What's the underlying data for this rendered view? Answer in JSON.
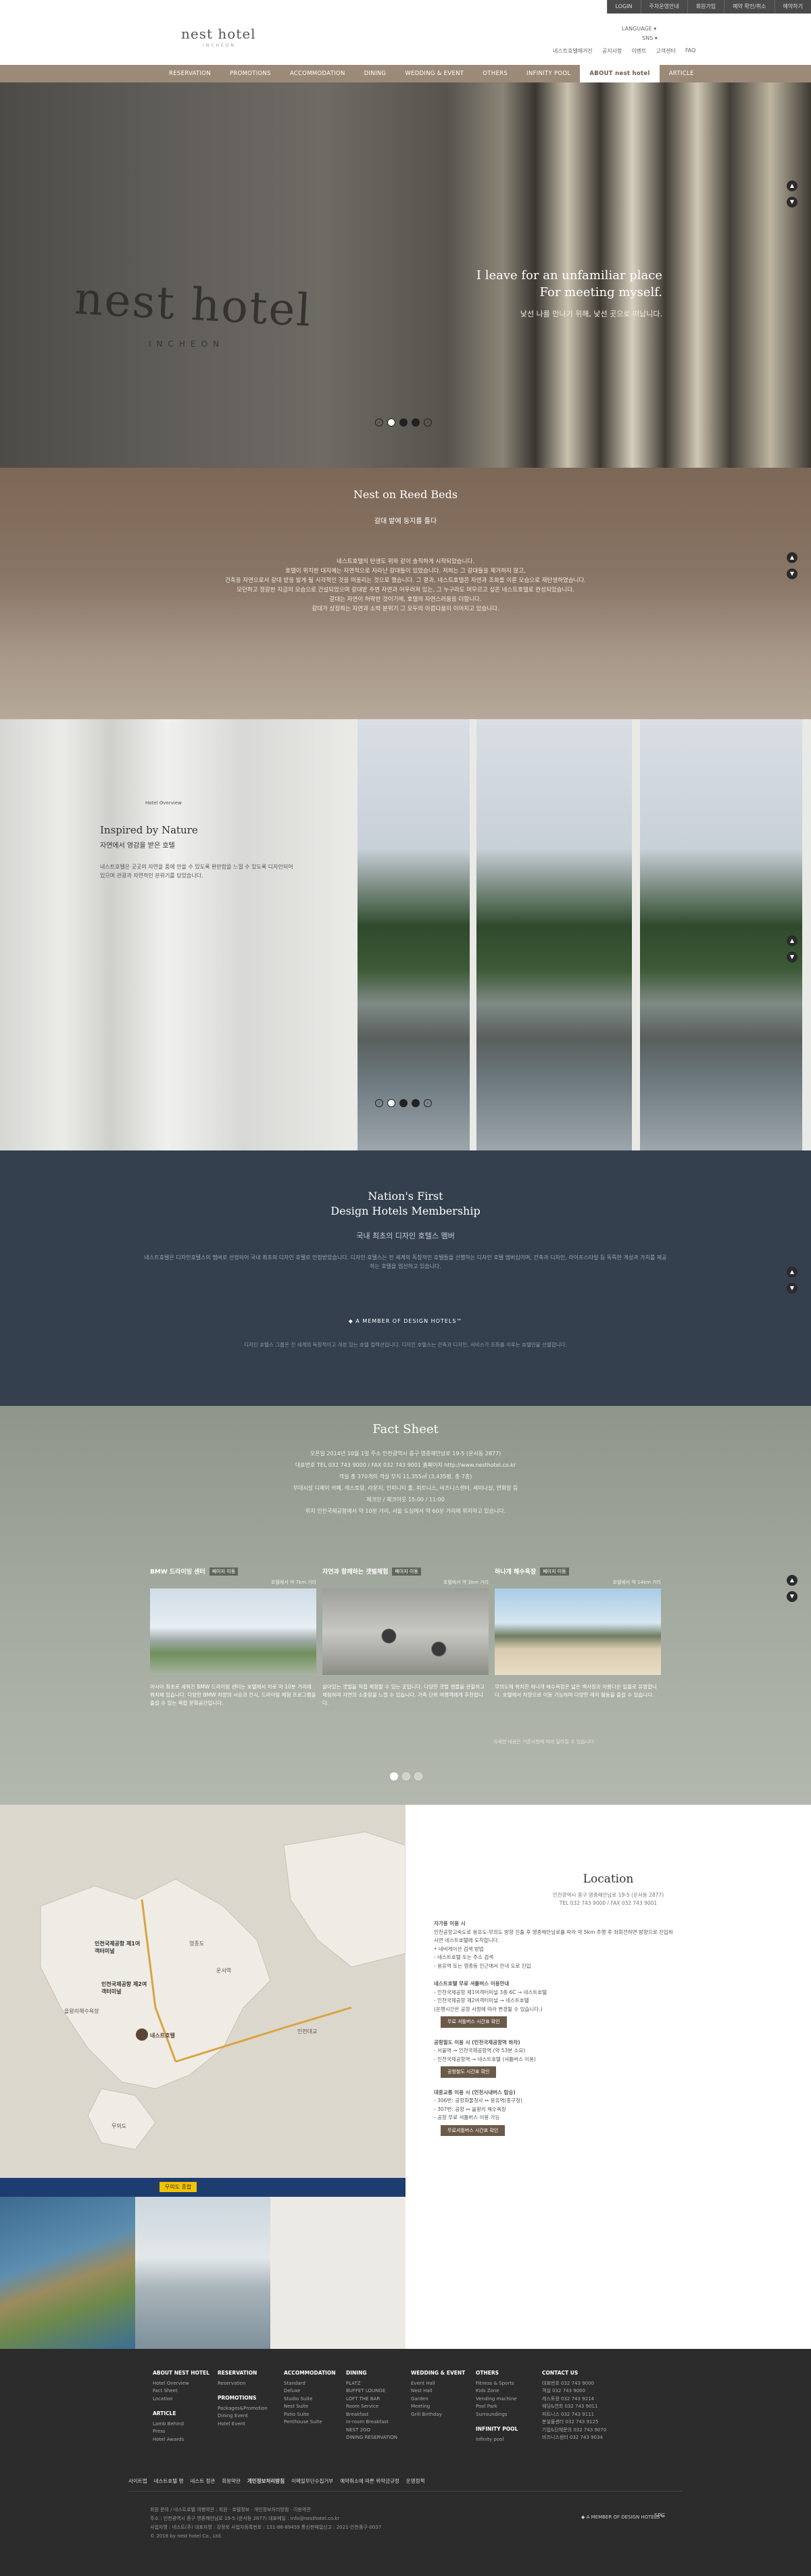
{
  "topbar": {
    "links": [
      "LOGIN",
      "주차운영안내",
      "회원가입",
      "예약 확인/취소",
      "예약하기"
    ]
  },
  "header": {
    "logo": "nest hotel",
    "logo_sub": "INCHEON",
    "language": "LANGUAGE",
    "sns": "SNS",
    "util_links": [
      "네스트호텔매거진",
      "공지사항",
      "이벤트",
      "고객센터",
      "FAQ"
    ]
  },
  "nav": {
    "items": [
      "RESERVATION",
      "PROMOTIONS",
      "ACCOMMODATION",
      "DINING",
      "WEDDING & EVENT",
      "OTHERS",
      "INFINITY POOL",
      "ABOUT nest hotel",
      "ARTICLE"
    ],
    "active_index": 7
  },
  "hero": {
    "logo_text": "nest hotel",
    "logo_sub": "INCHEON",
    "line1": "I leave for an unfamiliar place",
    "line2": "For meeting myself.",
    "line3": "낯선 나를 만나기 위해, 낯선 곳으로 떠납니다.",
    "slide_index": 1,
    "slide_count": 3
  },
  "reed": {
    "title": "Nest on Reed Beds",
    "subtitle": "갈대 밭에 둥지를 틀다",
    "body": [
      "네스트호텔의 탄생도 위와 같이 솔직하게 시작되었습니다.",
      "호텔이 위치한 대지에는 자연적으로 자라난 갈대들이 있었습니다. 저희는 그 갈대들을 제거하지 않고,",
      "건축을 자연으로서 갈대 밭을 밟게 될 시각적인 것을 떠올리는 것으로 했습니다. 그 결과, 네스트호텔은 자연과 조화를 이룬 모습으로 재탄생하였습니다.",
      "모던하고 정갈한 지금의 모습으로 건설되었으며 갈대밭 주변 자연과 어우러져 있는, 그 누구라도 머무르고 싶은 네스트호텔로 완성되었습니다.",
      "갈대는 자연이 허락한 것이기에, 호텔의 자연스러움을 더합니다.",
      "갈대가 상징하는 자연과 소박 분위기 그 모두의 아름다움이 이어지고 있습니다."
    ]
  },
  "inspired": {
    "eyebrow": "Hotel Overview",
    "title": "Inspired by Nature",
    "subtitle": "자연에서 영감을 받은 호텔",
    "body": "네스트호텔은 곳곳의 자연을 품에 안을 수 있도록 완만함을 느낄 수 있도록 디자인되어 있으며 관광과 자연적인 분위기를 담았습니다.",
    "slide_index": 0,
    "slide_count": 3
  },
  "membership": {
    "title_line1": "Nation's First",
    "title_line2": "Design Hotels  Membership",
    "subtitle": "국내 최초의 디자인 호텔스 멤버",
    "body": "네스트호텔은 디자인호텔스의 멤버로 선정되어 국내 최초의 디자인 호텔로 인정받았습니다. 디자인 호텔스는 전 세계의 독창적인 호텔들을 선별하는 디자인 호텔 멤버십이며, 건축과 디자인, 라이프스타일 등 독특한 개성과 가치를 제공하는 호텔을 엄선하고 있습니다.",
    "badge": "A MEMBER OF DESIGN HOTELS™",
    "badge_note": "디자인 호텔스 그룹은 전 세계의 독창적이고 개성 있는 호텔 컬렉션입니다. 디자인 호텔스는 건축과 디자인, 서비스가 조화를 이루는 호텔만을 선별합니다."
  },
  "fact": {
    "title": "Fact Sheet",
    "rows": [
      "오픈일  2014년 10월 1일    주소  인천광역시 중구 영종해안남로 19-5 (운서동 2877)",
      "대표번호  TEL 032 743 9000 / FAX 032 743 9001    홈페이지  http://www.nesthotel.co.kr",
      "객실  총 370개의 객실    부지  11,355㎡ (3,435평, 총 7층)",
      "부대시설  디제이 카페, 레스토랑, 라운지, 인피니티 풀, 피트니스, 비즈니스센터, 세미나실, 연회장 등",
      "체크인 / 체크아웃  15:00 / 11:00",
      "위치  인천국제공항에서 약 10분 거리, 서울 도심에서 약 60분 거리에 위치하고 있습니다."
    ],
    "columns": [
      {
        "title": "BMW 드라이빙 센터",
        "tag": "페이지 이동",
        "sub": "호텔에서 약 7km 거리",
        "text": "아시아 최초로 세워진 BMW 드라이빙 센터는 호텔에서 차로 약 10분 거리에 위치해 있습니다. 다양한 BMW 차량의 시승과 전시, 드라이빙 체험 프로그램을 즐길 수 있는 복합 문화공간입니다."
      },
      {
        "title": "자연과 함께하는 갯벌체험",
        "tag": "페이지 이동",
        "sub": "호텔에서 약 3km 거리",
        "text": "살아있는 갯벌을 직접 체험할 수 있는 곳입니다. 다양한 갯벌 생물을 관찰하고 체험하며 자연의 소중함을 느낄 수 있습니다. 가족 단위 여행객에게 추천합니다."
      },
      {
        "title": "하나개 해수욕장",
        "tag": "페이지 이동",
        "sub": "호텔에서 약 14km 거리",
        "text": "무의도에 위치한 하나개 해수욕장은 넓은 백사장과 아름다운 일몰로 유명합니다. 호텔에서 차량으로 이동 가능하며 다양한 레저 활동을 즐길 수 있습니다."
      }
    ],
    "note": "자세한 내용은 기준사항에 따라 달라질 수 있습니다.",
    "slide_index": 0,
    "slide_count": 3
  },
  "location": {
    "title": "Location",
    "address": "인천광역시 중구 영종해안남로 19-5 (운서동 2877)",
    "tel": "TEL 032 743 9000 / FAX 032 743 9001",
    "body_sections": [
      {
        "head": "자가용 이용 시",
        "lines": [
          "인천공항고속도로 용유도-무의도 방향 진출 후 영종해안남로를 따라 약 5km 주행 후 좌회전하면 방향으로 진입하시면 네스트호텔에 도착합니다.",
          "• 네비게이션 검색 방법",
          "  - 네스트호텔 또는 주소 검색",
          "  - 용유역 또는 영종동 인근에서 안내 도로 진입"
        ]
      },
      {
        "head": "네스트호텔 무료 셔틀버스 이용안내",
        "lines": [
          "- 인천국제공항 제1여객터미널 3층 6C → 네스트호텔",
          "- 인천국제공항 제2여객터미널 → 네스트호텔",
          "  (운행시간은 공항 사정에 따라 변경될 수 있습니다.)"
        ]
      },
      {
        "head": "공항철도 이용 시 (인천국제공항역 하차)",
        "lines": [
          "- 서울역 → 인천국제공항역 (약 53분 소요)",
          "- 인천국제공항역 → 네스트호텔 (셔틀버스 이용)"
        ]
      },
      {
        "head": "대중교통 이용 시 (인천시내버스 탑승)",
        "lines": [
          "- 306번: 공항화물청사 ↔ 용유역(중구청)",
          "- 307번: 공항 ↔ 을왕리 해수욕장",
          "- 공항 무료 셔틀버스 이용 가능"
        ]
      }
    ],
    "btn_shuttle": "무료 셔틀버스 시간표 확인",
    "btn_rail": "공항철도 시간표 확인",
    "btn_bus": "무료셔틀버스 시간표 확인",
    "map_labels": [
      "인천국제공항 제1여객터미널",
      "인천국제공항 제2여객터미널",
      "네스트호텔",
      "영종도",
      "무의도",
      "을왕리해수욕장",
      "운서역",
      "인천대교"
    ],
    "strip_label": "무의도 종합"
  },
  "footer": {
    "columns": [
      {
        "head": "ABOUT NEST HOTEL",
        "items": [
          "Hotel Overview",
          "Fact Sheet",
          "Location"
        ]
      },
      {
        "head": "ARTICLE",
        "items": [
          "Lamb Behind",
          "Press",
          "Hotel Awards"
        ]
      },
      {
        "head": "RESERVATION",
        "items": [
          "Reservation"
        ]
      },
      {
        "head": "PROMOTIONS",
        "items": [
          "Packages&Promotion",
          "Dining Event",
          "Hotel Event"
        ]
      },
      {
        "head": "ACCOMMODATION",
        "items": [
          "Standard",
          "Deluxe",
          "Studio Suite",
          "Nest Suite",
          "Patio Suite",
          "Penthouse Suite"
        ]
      },
      {
        "head": "DINING",
        "items": [
          "PLATZ",
          "BUFFET LOUNGE",
          "LOFT THE BAR",
          "Room Service",
          "Breakfast",
          "In-room Breakfast",
          "NEST 2GO",
          "DINING RESERVATION"
        ]
      },
      {
        "head": "WEDDING & EVENT",
        "items": [
          "Event Hall",
          "Nest Hall",
          "Garden",
          "Meeting",
          "Grill Birthday"
        ]
      },
      {
        "head": "OTHERS",
        "items": [
          "Fitness & Sports",
          "Kids Zone",
          "Vending machine",
          "Pool Park",
          "Surroundings"
        ]
      },
      {
        "head": "INFINITY POOL",
        "items": [
          "Infinity pool"
        ]
      },
      {
        "head": "CONTACT US",
        "items": [
          "대표번호  032 743 9000",
          "객실  032 743 9000",
          "레스토랑  032 743 9214",
          "웨딩&연회  032 743 9011",
          "피트니스  032 743 9111",
          "분실물센터  032 743 9125",
          "기업&단체문의  032 743 9070",
          "비즈니스센터  032 743 9034"
        ]
      }
    ],
    "links": [
      "사이트맵",
      "네스트호텔 행",
      "네스트 정관",
      "회원약관",
      "개인정보처리방침",
      "이메일무단수집거부",
      "예약취소에 따른 위약금규정",
      "운영정책"
    ],
    "info_line1": "회원 문의 / 네스트호텔 여행약관 : 회원 · 호텔정보 · 개인정보처리방침 · 이용약관",
    "info_line2": "주소 : 인천광역시 중구 영종해안남로 19-5 (운서동 2877)  대표메일 : info@nesthotel.co.kr",
    "info_line3": "사업자명 : 네스트(주)  대표자명 : 강정욱  사업자등록번호 : 131-86-89459  통신판매업신고 : 2021-인천중구-0037",
    "copyright": "© 2018 by nest hotel Co., Ltd.",
    "badge": "A MEMBER OF DESIGN HOTELS™",
    "badge2": "SPG"
  },
  "colors": {
    "nav": "#9b8a78",
    "reed": "#7d6756",
    "membership": "#34404e",
    "fact": "#8e968b",
    "footer": "#2c2c2c"
  }
}
